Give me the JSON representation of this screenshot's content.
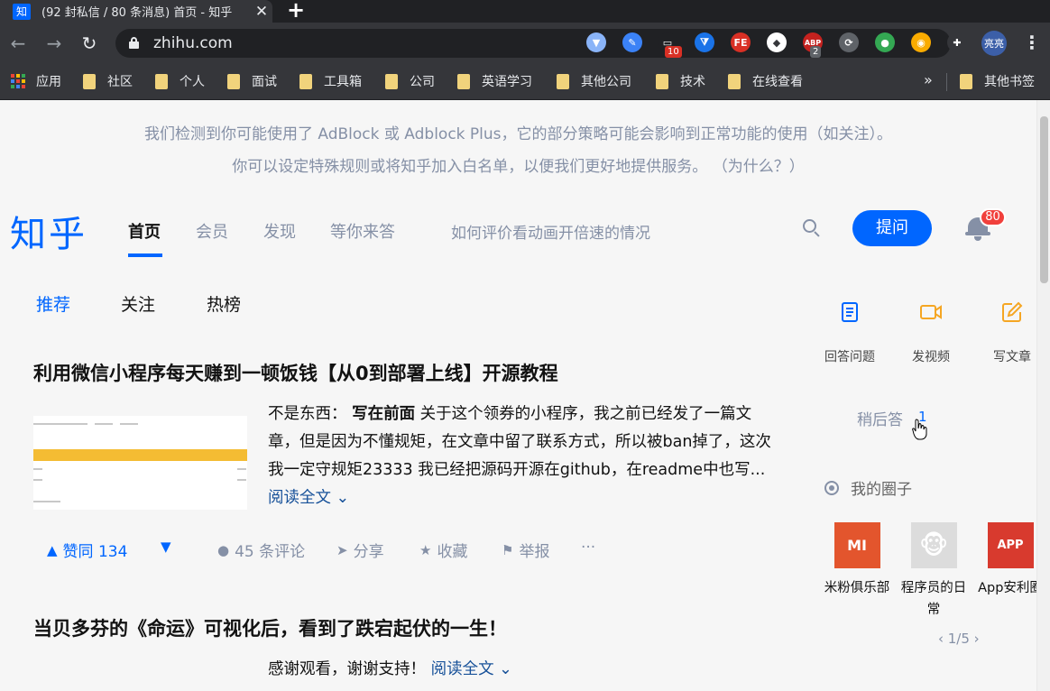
{
  "browser": {
    "tab_title": "(92 封私信 / 80 条消息) 首页 - 知乎",
    "tab_favicon": "知",
    "new_tab_glyph": "+",
    "close_glyph": "✕",
    "url": "zhihu.com",
    "profile_name": "亮亮",
    "extensions": [
      {
        "name": "vue-devtools-icon",
        "color": "#8ab4f8",
        "glyph": "▼"
      },
      {
        "name": "edit-icon",
        "color": "#3b82f6",
        "glyph": "✎"
      },
      {
        "name": "extension-icon",
        "color": "#202124",
        "glyph": "▭",
        "badge": "10"
      },
      {
        "name": "dropbox-icon",
        "color": "#1a73e8",
        "glyph": "⧩"
      },
      {
        "name": "fe-helper-icon",
        "color": "#d93025",
        "glyph": "FE"
      },
      {
        "name": "diamond-icon",
        "color": "#ffffff",
        "glyph": "◆"
      },
      {
        "name": "adblock-plus-icon",
        "color": "#c5221f",
        "glyph": "ABP",
        "badge": "2"
      },
      {
        "name": "grey-circle-icon",
        "color": "#5f6368",
        "glyph": "⟳"
      },
      {
        "name": "colorful-icon",
        "color": "#34a853",
        "glyph": "●"
      },
      {
        "name": "eyes-icon",
        "color": "#f9ab00",
        "glyph": "◉"
      },
      {
        "name": "puzzle-icon",
        "color": "#35363a",
        "glyph": "✚"
      }
    ],
    "bookmarks": [
      {
        "label": "应用",
        "type": "apps"
      },
      {
        "label": "社区",
        "type": "folder"
      },
      {
        "label": "个人",
        "type": "folder"
      },
      {
        "label": "面试",
        "type": "folder"
      },
      {
        "label": "工具箱",
        "type": "folder"
      },
      {
        "label": "公司",
        "type": "folder"
      },
      {
        "label": "英语学习",
        "type": "folder"
      },
      {
        "label": "其他公司",
        "type": "folder"
      },
      {
        "label": "技术",
        "type": "folder"
      },
      {
        "label": "在线查看",
        "type": "folder"
      }
    ],
    "other_bookmarks": "其他书签",
    "more_bookmarks": "»"
  },
  "adblock_notice": {
    "line1": "我们检测到你可能使用了 AdBlock 或 Adblock Plus，它的部分策略可能会影响到正常功能的使用（如关注）。",
    "line2": "你可以设定特殊规则或将知乎加入白名单，以便我们更好地提供服务。 （为什么？）"
  },
  "header": {
    "logo": "知乎",
    "nav": [
      "首页",
      "会员",
      "发现",
      "等你来答"
    ],
    "search_placeholder": "如何评价看动画开倍速的情况",
    "ask_button": "提问",
    "notifications_count": "80"
  },
  "feed_tabs": [
    "推荐",
    "关注",
    "热榜"
  ],
  "cards": [
    {
      "title": "利用微信小程序每天赚到一顿饭钱【从0到部署上线】开源教程",
      "author": "不是东西：",
      "bold_lead": "写在前面",
      "excerpt": "关于这个领券的小程序，我之前已经发了一篇文章，但是因为不懂规矩，在文章中留了联系方式，所以被ban掉了，这次我一定守规矩23333 我已经把源码开源在github，在readme中也写...",
      "read_more": "阅读全文 ⌄",
      "actions": {
        "upvote": "赞同 134",
        "comments": "45 条评论",
        "share": "分享",
        "collect": "收藏",
        "report": "举报",
        "more": "···"
      }
    },
    {
      "title": "当贝多芬的《命运》可视化后，看到了跌宕起伏的一生！",
      "excerpt": "感谢观看，谢谢支持！",
      "read_more": "阅读全文 ⌄"
    }
  ],
  "sidebar": {
    "create": [
      {
        "label": "回答问题",
        "color": "#0066ff"
      },
      {
        "label": "发视频",
        "color": "#f5a623"
      },
      {
        "label": "写文章",
        "color": "#f5a623"
      }
    ],
    "later_label": "稍后答",
    "later_count": "1",
    "circles_title": "我的圈子",
    "circles": [
      {
        "name": "米粉俱乐部",
        "logo": "MI",
        "color": "#e3552d"
      },
      {
        "name": "程序员的日常",
        "logo": "🐵",
        "color": "#dcdcdc"
      },
      {
        "name": "App安利圈",
        "logo": "APP",
        "color": "#d83a2e"
      }
    ],
    "pager": "‹   1/5   ›"
  }
}
